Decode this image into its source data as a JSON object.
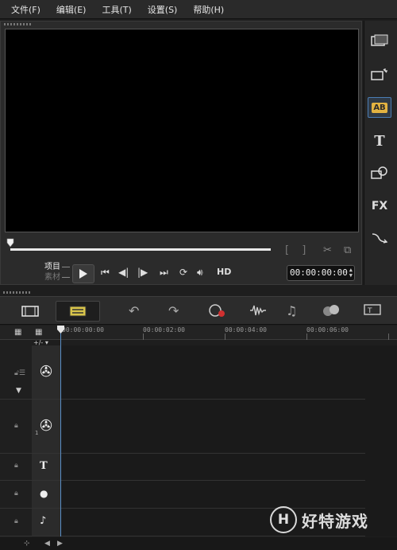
{
  "menu": [
    "文件(F)",
    "编辑(E)",
    "工具(T)",
    "设置(S)",
    "帮助(H)"
  ],
  "player": {
    "mode_project": "项目",
    "mode_clip": "素材",
    "hd_label": "HD",
    "timecode": "00:00:00:00",
    "mark_brackets": "[ ]",
    "scrub_progress": 0
  },
  "library_tabs": [
    {
      "icon": "media-library-icon",
      "active": false
    },
    {
      "icon": "instant-project-icon",
      "active": false
    },
    {
      "icon": "transition-icon",
      "label": "AB",
      "active": true
    },
    {
      "icon": "title-icon",
      "label": "T",
      "active": false
    },
    {
      "icon": "graphics-icon",
      "active": false
    },
    {
      "icon": "filter-icon",
      "label": "FX",
      "active": false
    },
    {
      "icon": "path-icon",
      "active": false
    }
  ],
  "timeline": {
    "ruler_labels": [
      "00:00:00:00",
      "00:00:02:00",
      "00:00:04:00",
      "00:00:06:00"
    ],
    "small_controls": "+/- ▾",
    "tracks": [
      {
        "name": "video-track",
        "icon": "film-reel-icon"
      },
      {
        "name": "overlay-track",
        "icon": "film-reel-icon",
        "number": "1"
      },
      {
        "name": "title-track",
        "icon": "title-T-icon",
        "label": "T"
      },
      {
        "name": "voice-track",
        "icon": "microphone-icon"
      },
      {
        "name": "music-track",
        "icon": "music-note-icon"
      }
    ]
  },
  "watermark": {
    "logo": "H",
    "text": "好特游戏"
  }
}
